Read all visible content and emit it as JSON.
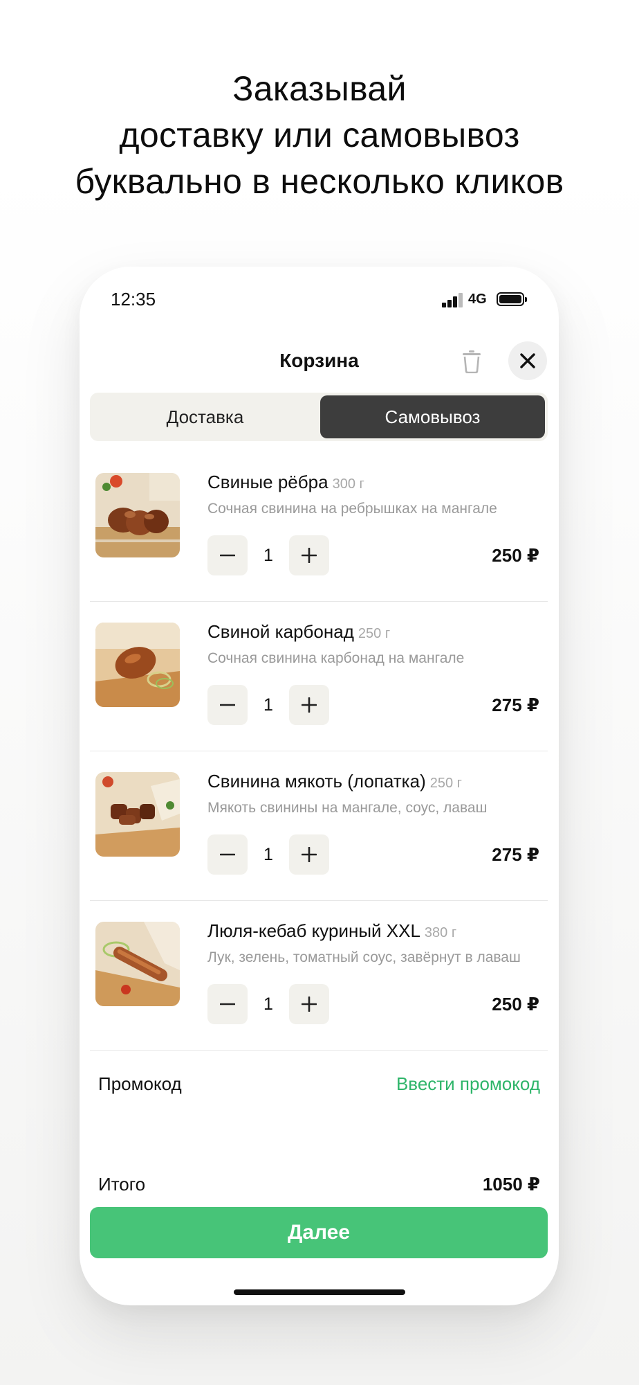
{
  "headline": {
    "line1": "Заказывай",
    "line2": "доставку или самовывоз",
    "line3": "буквально в несколько кликов"
  },
  "status_bar": {
    "time": "12:35",
    "network": "4G",
    "icons": [
      "signal-icon",
      "battery-icon"
    ]
  },
  "cart": {
    "title": "Корзина",
    "icons": {
      "trash": "trash-icon",
      "close": "close-icon"
    },
    "tabs": [
      {
        "label": "Доставка",
        "selected": false
      },
      {
        "label": "Самовывоз",
        "selected": true
      }
    ],
    "items": [
      {
        "name": "Свиные рёбра",
        "weight": "300 г",
        "description": "Сочная свинина на ребрышках на мангале",
        "quantity": "1",
        "price": "250 ₽"
      },
      {
        "name": "Свиной карбонад",
        "weight": "250 г",
        "description": "Сочная свинина карбонад на мангале",
        "quantity": "1",
        "price": "275 ₽"
      },
      {
        "name": "Свинина мякоть (лопатка)",
        "weight": "250 г",
        "description": "Мякоть свинины на мангале, соус, лаваш",
        "quantity": "1",
        "price": "275 ₽"
      },
      {
        "name": "Люля-кебаб куриный XXL",
        "weight": "380 г",
        "description": "Лук, зелень, томатный соус, завёрнут в лаваш",
        "quantity": "1",
        "price": "250 ₽"
      }
    ],
    "promo": {
      "label": "Промокод",
      "action": "Ввести промокод"
    },
    "total": {
      "label": "Итого",
      "value": "1050 ₽"
    },
    "next_button": "Далее",
    "colors": {
      "accent_green": "#47c478",
      "promo_green": "#2fb56a",
      "dark_tab": "#3d3d3d"
    }
  }
}
